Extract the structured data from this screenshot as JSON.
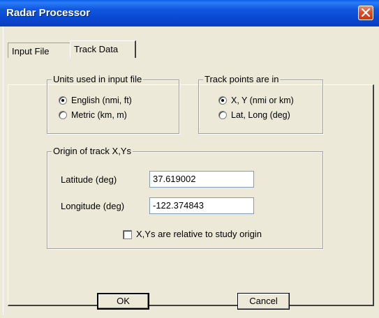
{
  "window": {
    "title": "Radar Processor"
  },
  "tabs": [
    {
      "label": "Input File"
    },
    {
      "label": "Track Data"
    }
  ],
  "units_group": {
    "legend": "Units used in input file",
    "options": [
      {
        "label": "English (nmi, ft)",
        "checked": true
      },
      {
        "label": "Metric (km, m)",
        "checked": false
      }
    ]
  },
  "track_points_group": {
    "legend": "Track points are in",
    "options": [
      {
        "label": "X, Y (nmi or km)",
        "checked": true
      },
      {
        "label": "Lat, Long (deg)",
        "checked": false
      }
    ]
  },
  "origin_group": {
    "legend": "Origin of track X,Ys",
    "latitude_label": "Latitude (deg)",
    "latitude_value": "37.619002",
    "longitude_label": "Longitude (deg)",
    "longitude_value": "-122.374843",
    "relative_checkbox_label": "X,Ys are relative to study origin",
    "relative_checked": false
  },
  "buttons": {
    "ok": "OK",
    "cancel": "Cancel"
  },
  "colors": {
    "title_bar": "#0a47cf",
    "dialog_bg": "#ece9d8",
    "close_button": "#d9502b"
  }
}
